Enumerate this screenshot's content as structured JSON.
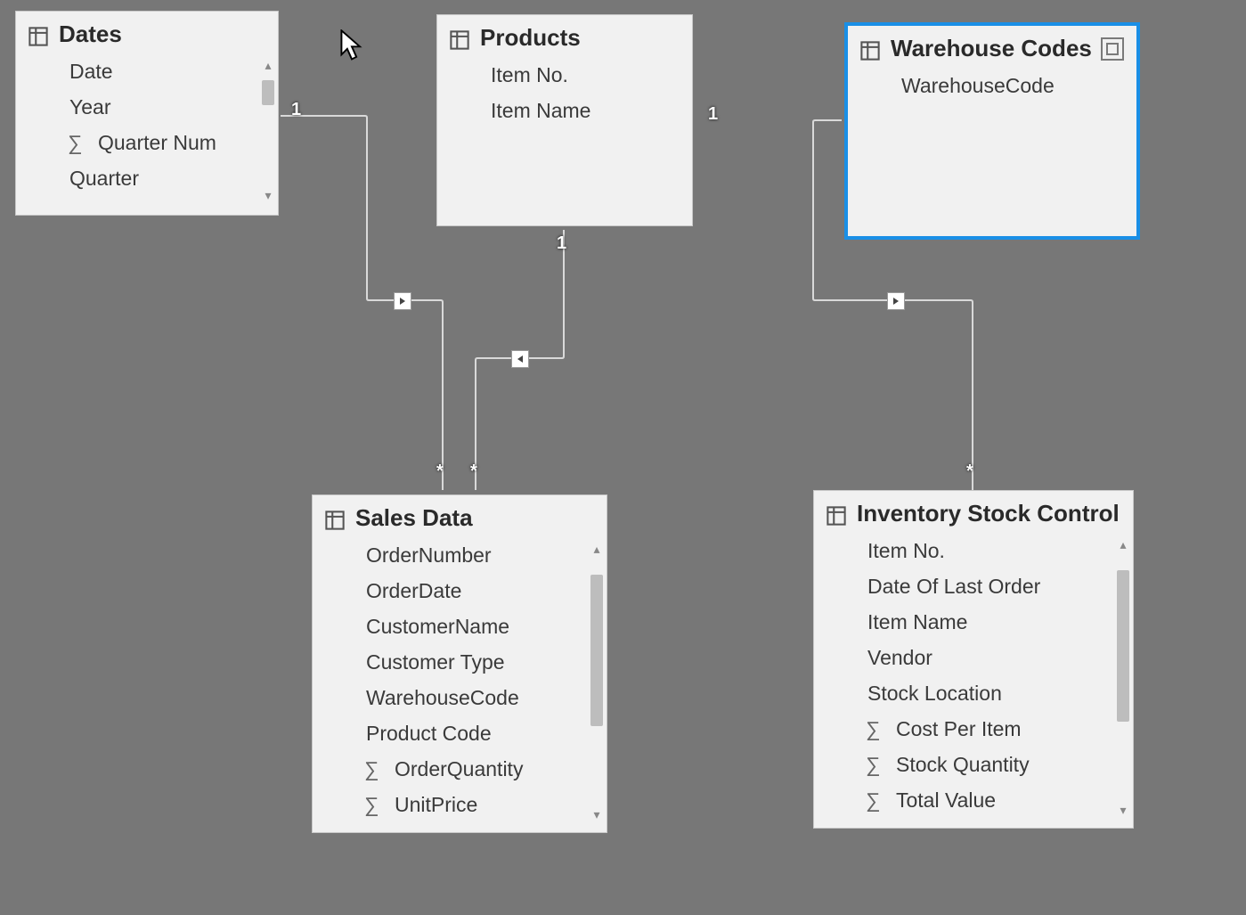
{
  "tables": {
    "dates": {
      "title": "Dates",
      "fields": [
        {
          "label": "Date",
          "sum": false
        },
        {
          "label": "Year",
          "sum": false
        },
        {
          "label": "Quarter Num",
          "sum": true
        },
        {
          "label": "Quarter",
          "sum": false
        }
      ]
    },
    "products": {
      "title": "Products",
      "fields": [
        {
          "label": "Item No.",
          "sum": false
        },
        {
          "label": "Item Name",
          "sum": false
        }
      ]
    },
    "warehouse": {
      "title": "Warehouse Codes",
      "fields": [
        {
          "label": "WarehouseCode",
          "sum": false
        }
      ]
    },
    "sales": {
      "title": "Sales Data",
      "fields": [
        {
          "label": "OrderNumber",
          "sum": false
        },
        {
          "label": "OrderDate",
          "sum": false
        },
        {
          "label": "CustomerName",
          "sum": false
        },
        {
          "label": "Customer Type",
          "sum": false
        },
        {
          "label": "WarehouseCode",
          "sum": false
        },
        {
          "label": "Product Code",
          "sum": false
        },
        {
          "label": "OrderQuantity",
          "sum": true
        },
        {
          "label": "UnitPrice",
          "sum": true
        }
      ]
    },
    "inventory": {
      "title": "Inventory Stock Control",
      "fields": [
        {
          "label": "Item No.",
          "sum": false
        },
        {
          "label": "Date Of Last Order",
          "sum": false
        },
        {
          "label": "Item Name",
          "sum": false
        },
        {
          "label": "Vendor",
          "sum": false
        },
        {
          "label": "Stock Location",
          "sum": false
        },
        {
          "label": "Cost Per Item",
          "sum": true
        },
        {
          "label": "Stock Quantity",
          "sum": true
        },
        {
          "label": "Total Value",
          "sum": true
        }
      ]
    }
  },
  "cardinality": {
    "dates_one": "1",
    "products_one": "1",
    "warehouse_one": "1",
    "sales_many_left": "*",
    "sales_many_right": "*",
    "inventory_many": "*"
  }
}
